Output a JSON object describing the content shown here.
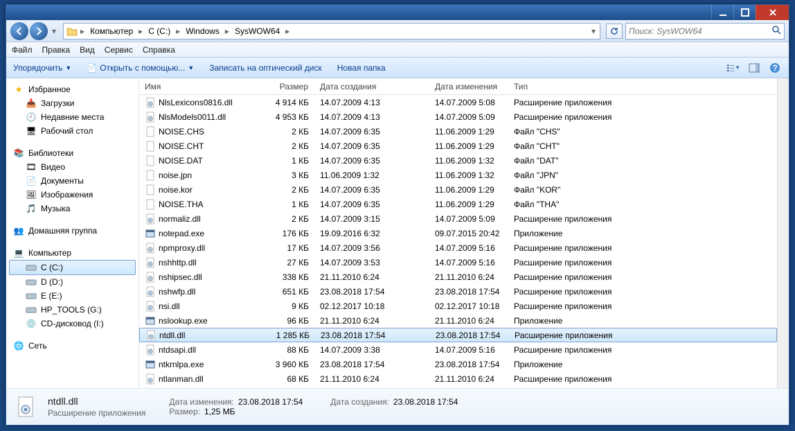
{
  "titlebar": {},
  "navbar": {
    "breadcrumbs": [
      "Компьютер",
      "C (C:)",
      "Windows",
      "SysWOW64"
    ],
    "search_placeholder": "Поиск: SysWOW64"
  },
  "menubar": [
    "Файл",
    "Правка",
    "Вид",
    "Сервис",
    "Справка"
  ],
  "toolbar": {
    "organize": "Упорядочить",
    "open_with": "Открыть с помощью...",
    "burn": "Записать на оптический диск",
    "new_folder": "Новая папка"
  },
  "sidebar": {
    "favorites": {
      "label": "Избранное",
      "items": [
        "Загрузки",
        "Недавние места",
        "Рабочий стол"
      ]
    },
    "libraries": {
      "label": "Библиотеки",
      "items": [
        "Видео",
        "Документы",
        "Изображения",
        "Музыка"
      ]
    },
    "homegroup": {
      "label": "Домашняя группа"
    },
    "computer": {
      "label": "Компьютер",
      "items": [
        "C (C:)",
        "D (D:)",
        "E (E:)",
        "HP_TOOLS (G:)",
        "CD-дисковод (I:)"
      ],
      "selected": 0
    },
    "network": {
      "label": "Сеть"
    }
  },
  "columns": {
    "name": "Имя",
    "size": "Размер",
    "created": "Дата создания",
    "modified": "Дата изменения",
    "type": "Тип"
  },
  "files": [
    {
      "icon": "dll",
      "name": "NlsLexicons0816.dll",
      "size": "4 914 КБ",
      "created": "14.07.2009 4:13",
      "modified": "14.07.2009 5:08",
      "type": "Расширение приложения"
    },
    {
      "icon": "dll",
      "name": "NlsModels0011.dll",
      "size": "4 953 КБ",
      "created": "14.07.2009 4:13",
      "modified": "14.07.2009 5:09",
      "type": "Расширение приложения"
    },
    {
      "icon": "file",
      "name": "NOISE.CHS",
      "size": "2 КБ",
      "created": "14.07.2009 6:35",
      "modified": "11.06.2009 1:29",
      "type": "Файл \"CHS\""
    },
    {
      "icon": "file",
      "name": "NOISE.CHT",
      "size": "2 КБ",
      "created": "14.07.2009 6:35",
      "modified": "11.06.2009 1:29",
      "type": "Файл \"CHT\""
    },
    {
      "icon": "file",
      "name": "NOISE.DAT",
      "size": "1 КБ",
      "created": "14.07.2009 6:35",
      "modified": "11.06.2009 1:32",
      "type": "Файл \"DAT\""
    },
    {
      "icon": "file",
      "name": "noise.jpn",
      "size": "3 КБ",
      "created": "11.06.2009 1:32",
      "modified": "11.06.2009 1:32",
      "type": "Файл \"JPN\""
    },
    {
      "icon": "file",
      "name": "noise.kor",
      "size": "2 КБ",
      "created": "14.07.2009 6:35",
      "modified": "11.06.2009 1:29",
      "type": "Файл \"KOR\""
    },
    {
      "icon": "file",
      "name": "NOISE.THA",
      "size": "1 КБ",
      "created": "14.07.2009 6:35",
      "modified": "11.06.2009 1:29",
      "type": "Файл \"THA\""
    },
    {
      "icon": "dll",
      "name": "normaliz.dll",
      "size": "2 КБ",
      "created": "14.07.2009 3:15",
      "modified": "14.07.2009 5:09",
      "type": "Расширение приложения"
    },
    {
      "icon": "exe",
      "name": "notepad.exe",
      "size": "176 КБ",
      "created": "19.09.2016 6:32",
      "modified": "09.07.2015 20:42",
      "type": "Приложение"
    },
    {
      "icon": "dll",
      "name": "npmproxy.dll",
      "size": "17 КБ",
      "created": "14.07.2009 3:56",
      "modified": "14.07.2009 5:16",
      "type": "Расширение приложения"
    },
    {
      "icon": "dll",
      "name": "nshhttp.dll",
      "size": "27 КБ",
      "created": "14.07.2009 3:53",
      "modified": "14.07.2009 5:16",
      "type": "Расширение приложения"
    },
    {
      "icon": "dll",
      "name": "nshipsec.dll",
      "size": "338 КБ",
      "created": "21.11.2010 6:24",
      "modified": "21.11.2010 6:24",
      "type": "Расширение приложения"
    },
    {
      "icon": "dll",
      "name": "nshwfp.dll",
      "size": "651 КБ",
      "created": "23.08.2018 17:54",
      "modified": "23.08.2018 17:54",
      "type": "Расширение приложения"
    },
    {
      "icon": "dll",
      "name": "nsi.dll",
      "size": "9 КБ",
      "created": "02.12.2017 10:18",
      "modified": "02.12.2017 10:18",
      "type": "Расширение приложения"
    },
    {
      "icon": "exe",
      "name": "nslookup.exe",
      "size": "96 КБ",
      "created": "21.11.2010 6:24",
      "modified": "21.11.2010 6:24",
      "type": "Приложение"
    },
    {
      "icon": "dll",
      "name": "ntdll.dll",
      "size": "1 285 КБ",
      "created": "23.08.2018 17:54",
      "modified": "23.08.2018 17:54",
      "type": "Расширение приложения",
      "selected": true
    },
    {
      "icon": "dll",
      "name": "ntdsapi.dll",
      "size": "88 КБ",
      "created": "14.07.2009 3:38",
      "modified": "14.07.2009 5:16",
      "type": "Расширение приложения"
    },
    {
      "icon": "exe",
      "name": "ntkrnlpa.exe",
      "size": "3 960 КБ",
      "created": "23.08.2018 17:54",
      "modified": "23.08.2018 17:54",
      "type": "Приложение"
    },
    {
      "icon": "dll",
      "name": "ntlanman.dll",
      "size": "68 КБ",
      "created": "21.11.2010 6:24",
      "modified": "21.11.2010 6:24",
      "type": "Расширение приложения"
    }
  ],
  "details": {
    "name": "ntdll.dll",
    "type": "Расширение приложения",
    "modified_label": "Дата изменения:",
    "modified": "23.08.2018 17:54",
    "size_label": "Размер:",
    "size": "1,25 МБ",
    "created_label": "Дата создания:",
    "created": "23.08.2018 17:54"
  }
}
